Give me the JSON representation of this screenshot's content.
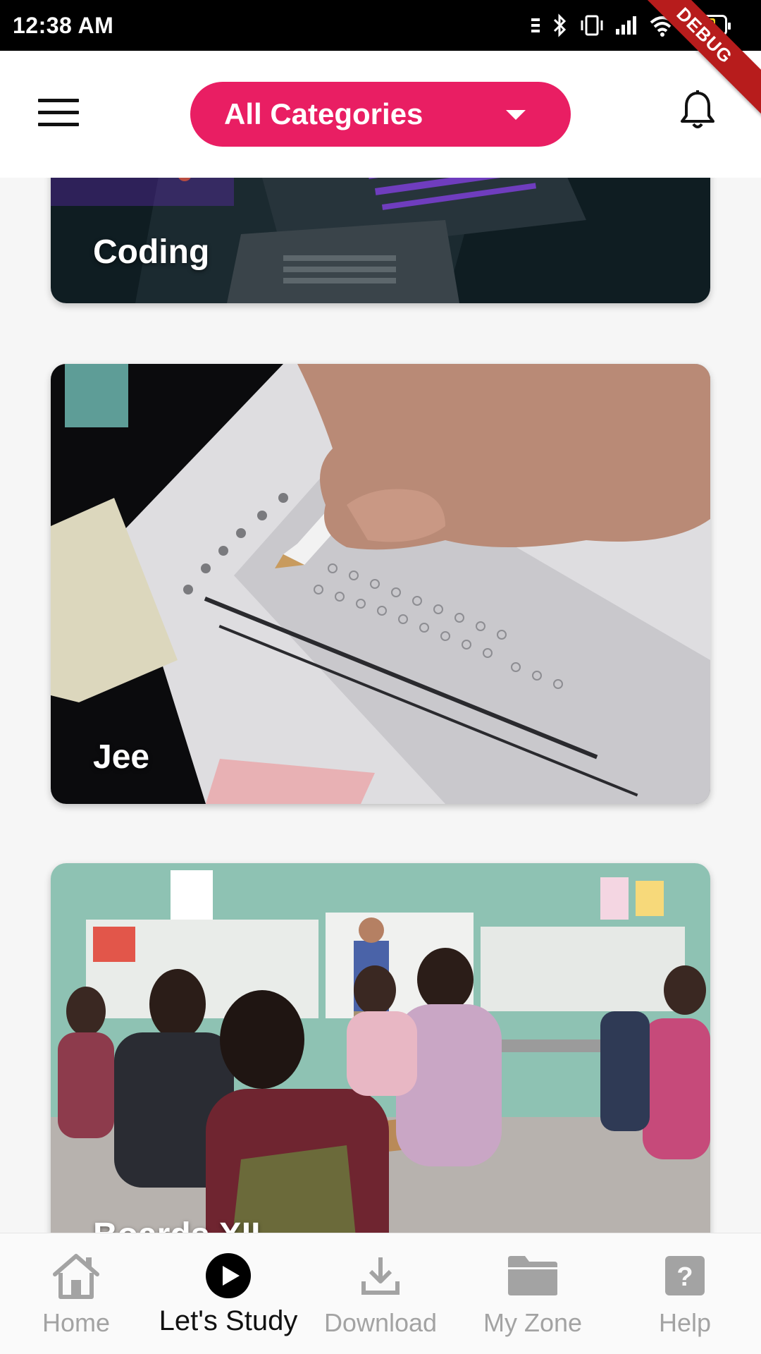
{
  "status_bar": {
    "time": "12:38 AM",
    "battery_level": "73",
    "icons": [
      "notification-icon",
      "bluetooth-icon",
      "vibrate-icon",
      "signal-icon",
      "wifi-icon",
      "battery-icon"
    ]
  },
  "debug_banner": "DEBUG",
  "header": {
    "category_label": "All Categories",
    "menu_icon": "hamburger-menu-icon",
    "bell_icon": "bell-icon",
    "accent_color": "#e91e63"
  },
  "categories": [
    {
      "title": "Coding"
    },
    {
      "title": "Jee"
    },
    {
      "title": "Boards XII"
    }
  ],
  "bottom_nav": {
    "items": [
      {
        "label": "Home",
        "icon": "home-icon",
        "active": false
      },
      {
        "label": "Let's Study",
        "icon": "play-icon",
        "active": true
      },
      {
        "label": "Download",
        "icon": "download-icon",
        "active": false
      },
      {
        "label": "My Zone",
        "icon": "folder-icon",
        "active": false
      },
      {
        "label": "Help",
        "icon": "help-icon",
        "active": false
      }
    ]
  }
}
